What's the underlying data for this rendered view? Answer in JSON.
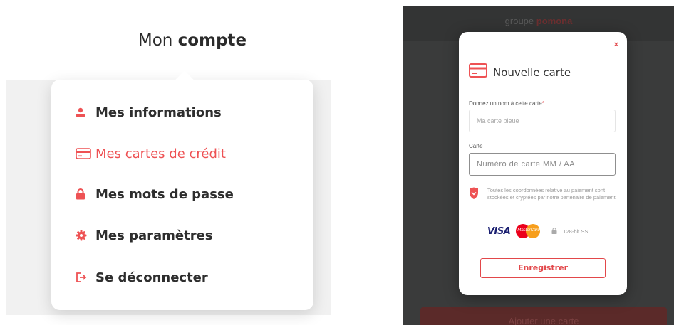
{
  "account_menu": {
    "title_prefix": "Mon",
    "title_bold": "compte",
    "items": [
      {
        "label": "Mes informations",
        "icon": "user-icon",
        "active": false
      },
      {
        "label": "Mes cartes de crédit",
        "icon": "credit-card-icon",
        "active": true
      },
      {
        "label": "Mes mots de passe",
        "icon": "lock-icon",
        "active": false
      },
      {
        "label": "Mes paramètres",
        "icon": "gear-icon",
        "active": false
      },
      {
        "label": "Se déconnecter",
        "icon": "logout-icon",
        "active": false
      }
    ]
  },
  "background_page": {
    "brand_prefix": "groupe",
    "brand_name": "pomona",
    "bottom_button": "Ajouter une carte"
  },
  "new_card_modal": {
    "close_label": "×",
    "title": "Nouvelle carte",
    "name_label": "Donnez un nom à cette carte",
    "name_required_mark": "*",
    "name_placeholder": "Ma carte bleue",
    "card_label": "Carte",
    "card_placeholder": "Numéro de carte  MM / AA",
    "security_note": "Toutes les coordonnées relative au paiement sont stockées et cryptées par notre partenaire de paiement.",
    "visa_label": "VISA",
    "mastercard_label": "MasterCard",
    "ssl_label": "128-bit SSL",
    "save_button": "Enregistrer"
  },
  "colors": {
    "accent": "#ee5254",
    "dark_background": "#3a3b3b"
  }
}
